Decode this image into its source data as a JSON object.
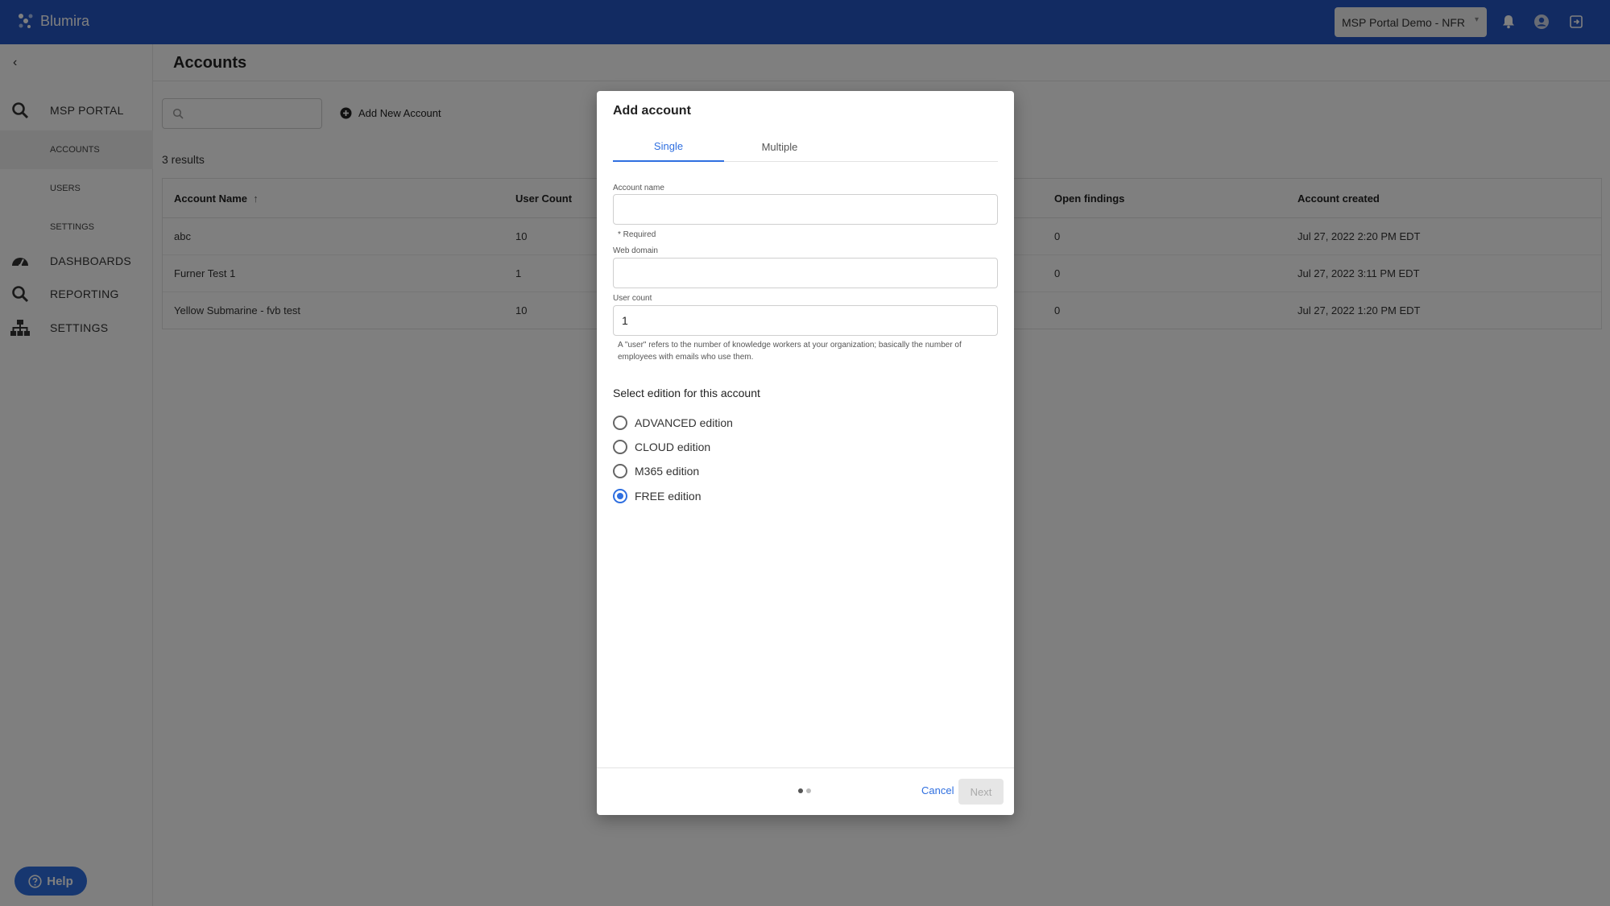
{
  "topbar": {
    "brand": "Blumira",
    "org_selector": "MSP Portal Demo - NFR",
    "icons": [
      "bell-icon",
      "user-icon",
      "logout-icon"
    ]
  },
  "sidebar": {
    "sections": [
      {
        "label": "MSP PORTAL",
        "icon": "search-icon"
      },
      {
        "label": "DASHBOARDS",
        "icon": "dashboard-icon"
      },
      {
        "label": "REPORTING",
        "icon": "search-icon"
      },
      {
        "label": "SETTINGS",
        "icon": "org-chart-icon"
      }
    ],
    "sub_items": [
      "ACCOUNTS",
      "USERS",
      "SETTINGS"
    ],
    "help_label": "Help"
  },
  "main": {
    "title": "Accounts",
    "search_placeholder": "",
    "add_new_label": "Add New Account",
    "results_text": "3 results",
    "columns": [
      "Account Name",
      "User Count",
      "Open findings",
      "Account created"
    ],
    "rows": [
      {
        "name": "abc",
        "users": "10",
        "findings": "0",
        "created": "Jul 27, 2022 2:20 PM EDT"
      },
      {
        "name": "Furner Test 1",
        "users": "1",
        "findings": "0",
        "created": "Jul 27, 2022 3:11 PM EDT"
      },
      {
        "name": "Yellow Submarine - fvb test",
        "users": "10",
        "findings": "0",
        "created": "Jul 27, 2022 1:20 PM EDT"
      }
    ]
  },
  "modal": {
    "title": "Add account",
    "tabs": [
      "Single",
      "Multiple"
    ],
    "active_tab": "Single",
    "account_name_label": "Account name",
    "account_name_value": "",
    "required_text": "* Required",
    "web_domain_label": "Web domain",
    "web_domain_value": "",
    "user_count_label": "User count",
    "user_count_value": "1",
    "user_count_help": "A \"user\" refers to the number of knowledge workers at your organization; basically the number of employees with emails who use them.",
    "edition_title": "Select edition for this account",
    "editions": [
      "ADVANCED edition",
      "CLOUD edition",
      "M365 edition",
      "FREE edition"
    ],
    "selected_edition": "FREE edition",
    "cancel_label": "Cancel",
    "next_label": "Next",
    "step": 1,
    "steps_total": 2
  },
  "colors": {
    "topbar": "#2556c4",
    "accent": "#2f6fe0"
  }
}
